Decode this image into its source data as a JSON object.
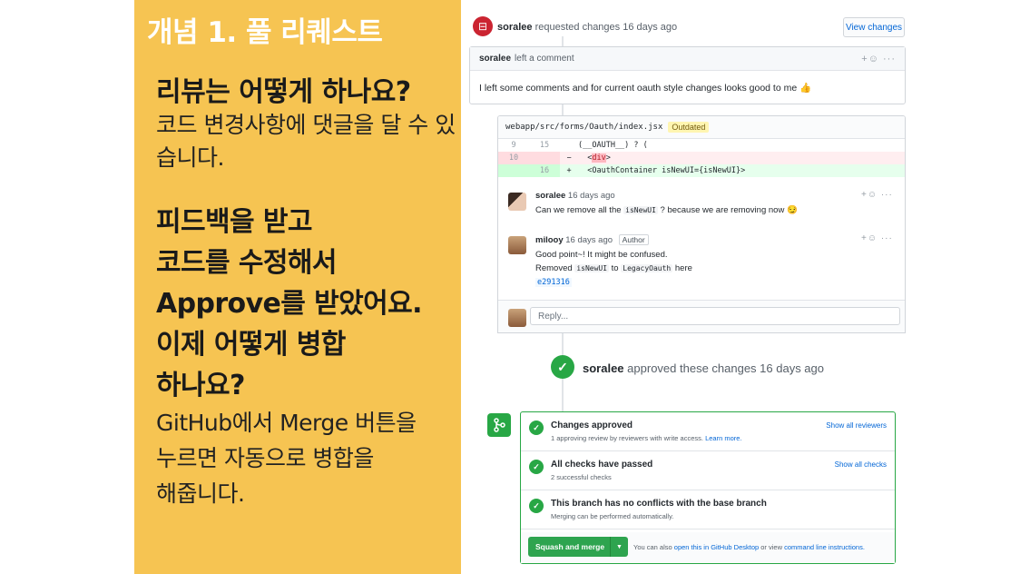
{
  "slide": {
    "title": "개념 1. 풀 리퀘스트",
    "heading1": "리뷰는 어떻게 하나요?",
    "para1": "코드 변경사항에 댓글을 달 수 있습니다.",
    "heading2": "피드백을 받고\n코드를 수정해서\nApprove를 받았어요.\n이제 어떻게 병합\n하나요?",
    "para2": "GitHub에서 Merge 버튼을\n누르면 자동으로 병합을\n해줍니다."
  },
  "request": {
    "user": "soralee",
    "action": "requested changes 16 days ago",
    "view_changes": "View changes"
  },
  "review": {
    "user": "soralee",
    "action": "left a comment",
    "body": "I left some comments and for current oauth style changes looks good to me",
    "emoji": "👍"
  },
  "file": {
    "path": "webapp/src/forms/Oauth/index.jsx",
    "badge": "Outdated",
    "diff": [
      {
        "old": "9",
        "new": "15",
        "sign": "",
        "code": "(__OAUTH__) ? ("
      },
      {
        "old": "10",
        "new": "",
        "sign": "−",
        "pre": "<",
        "kw": "div",
        "post": ">"
      },
      {
        "old": "",
        "new": "16",
        "sign": "+",
        "code": "<OauthContainer isNewUI={isNewUI}>"
      }
    ]
  },
  "comments": [
    {
      "user": "soralee",
      "time": "16 days ago",
      "text_a": "Can we remove all the",
      "code": "isNewUI",
      "text_b": "? because we are removing now",
      "emoji": "😏"
    },
    {
      "user": "milooy",
      "time": "16 days ago",
      "tag": "Author",
      "line1": "Good point~! It might be confused.",
      "line2_a": "Removed",
      "line2_code1": "isNewUI",
      "line2_b": "to",
      "line2_code2": "LegacyOauth",
      "line2_c": "here",
      "sha": "e291316"
    }
  ],
  "reply": {
    "placeholder": "Reply..."
  },
  "approval": {
    "user": "soralee",
    "action": "approved these changes 16 days ago"
  },
  "merge": {
    "rows": [
      {
        "title": "Changes approved",
        "sub": "1 approving review by reviewers with write access.",
        "sub_link": "Learn more.",
        "link": "Show all reviewers"
      },
      {
        "title": "All checks have passed",
        "sub": "2 successful checks",
        "sub_link": "",
        "link": "Show all checks"
      },
      {
        "title": "This branch has no conflicts with the base branch",
        "sub": "Merging can be performed automatically.",
        "sub_link": "",
        "link": ""
      }
    ],
    "button": "Squash and merge",
    "note_a": "You can also",
    "note_link1": "open this in GitHub Desktop",
    "note_b": "or view",
    "note_link2": "command line instructions."
  },
  "colors": {
    "slide_bg": "#f6c452",
    "accent_green": "#28a745",
    "link_blue": "#0366d6",
    "changes_red": "#cb2431"
  }
}
